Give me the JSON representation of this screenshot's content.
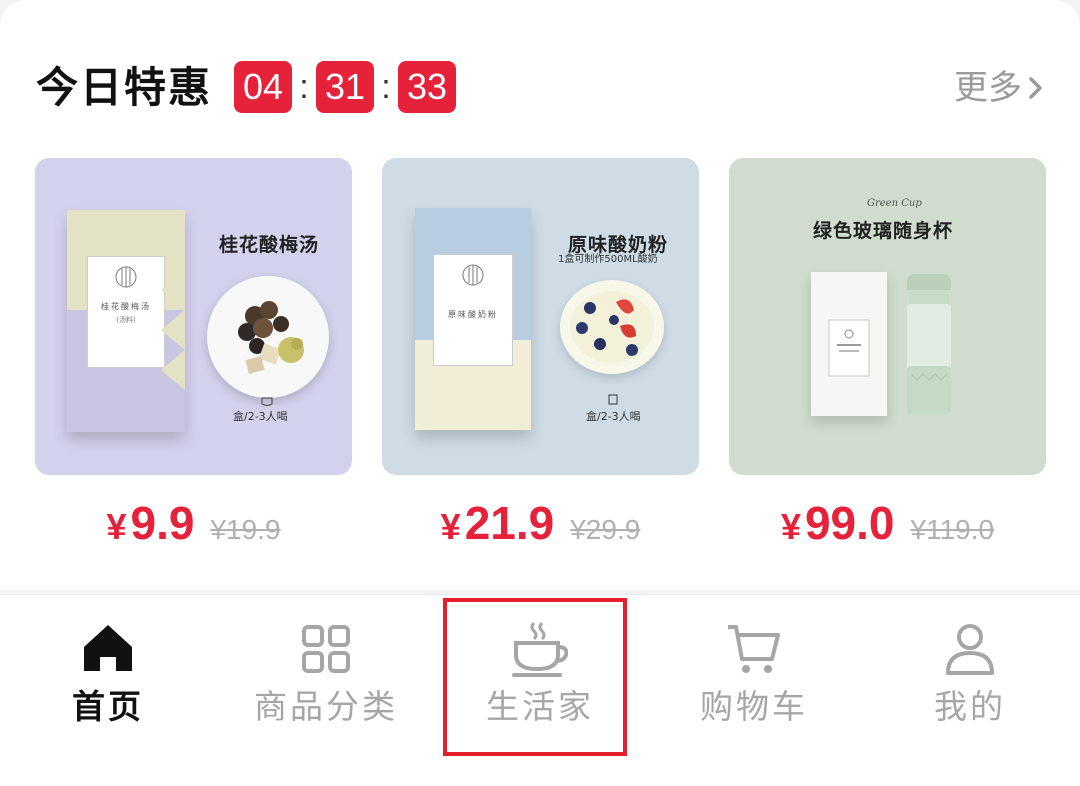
{
  "deal": {
    "title": "今日特惠",
    "countdown": {
      "hours": "04",
      "minutes": "31",
      "seconds": "33",
      "separator": ":"
    },
    "more_label": "更多"
  },
  "products": [
    {
      "name": "桂花酸梅汤",
      "box_text": "桂花酸梅汤",
      "box_sub": "(汤料)",
      "serving": "盒/2-3人喝",
      "price_symbol": "¥",
      "price": "9.9",
      "original_price": "¥19.9",
      "bg_color": "#d3d2ec"
    },
    {
      "name": "原味酸奶粉",
      "subtitle": "1盒可制作500ML酸奶",
      "box_text": "原味酸奶粉",
      "serving": "盒/2-3人喝",
      "price_symbol": "¥",
      "price": "21.9",
      "original_price": "¥29.9",
      "bg_color": "#cfdce6"
    },
    {
      "name": "绿色玻璃随身杯",
      "script_label": "Green Cup",
      "price_symbol": "¥",
      "price": "99.0",
      "original_price": "¥119.0",
      "bg_color": "#cfdcce"
    }
  ],
  "tabbar": {
    "items": [
      {
        "label": "首页",
        "icon": "home-icon",
        "active": true
      },
      {
        "label": "商品分类",
        "icon": "grid-icon",
        "active": false
      },
      {
        "label": "生活家",
        "icon": "coffee-cup-icon",
        "active": false,
        "highlighted": true
      },
      {
        "label": "购物车",
        "icon": "cart-icon",
        "active": false
      },
      {
        "label": "我的",
        "icon": "user-icon",
        "active": false
      }
    ]
  },
  "colors": {
    "accent": "#e6213a",
    "highlight_border": "#e41f2b",
    "inactive_tab": "#a6a6a6",
    "active_tab": "#111111"
  }
}
